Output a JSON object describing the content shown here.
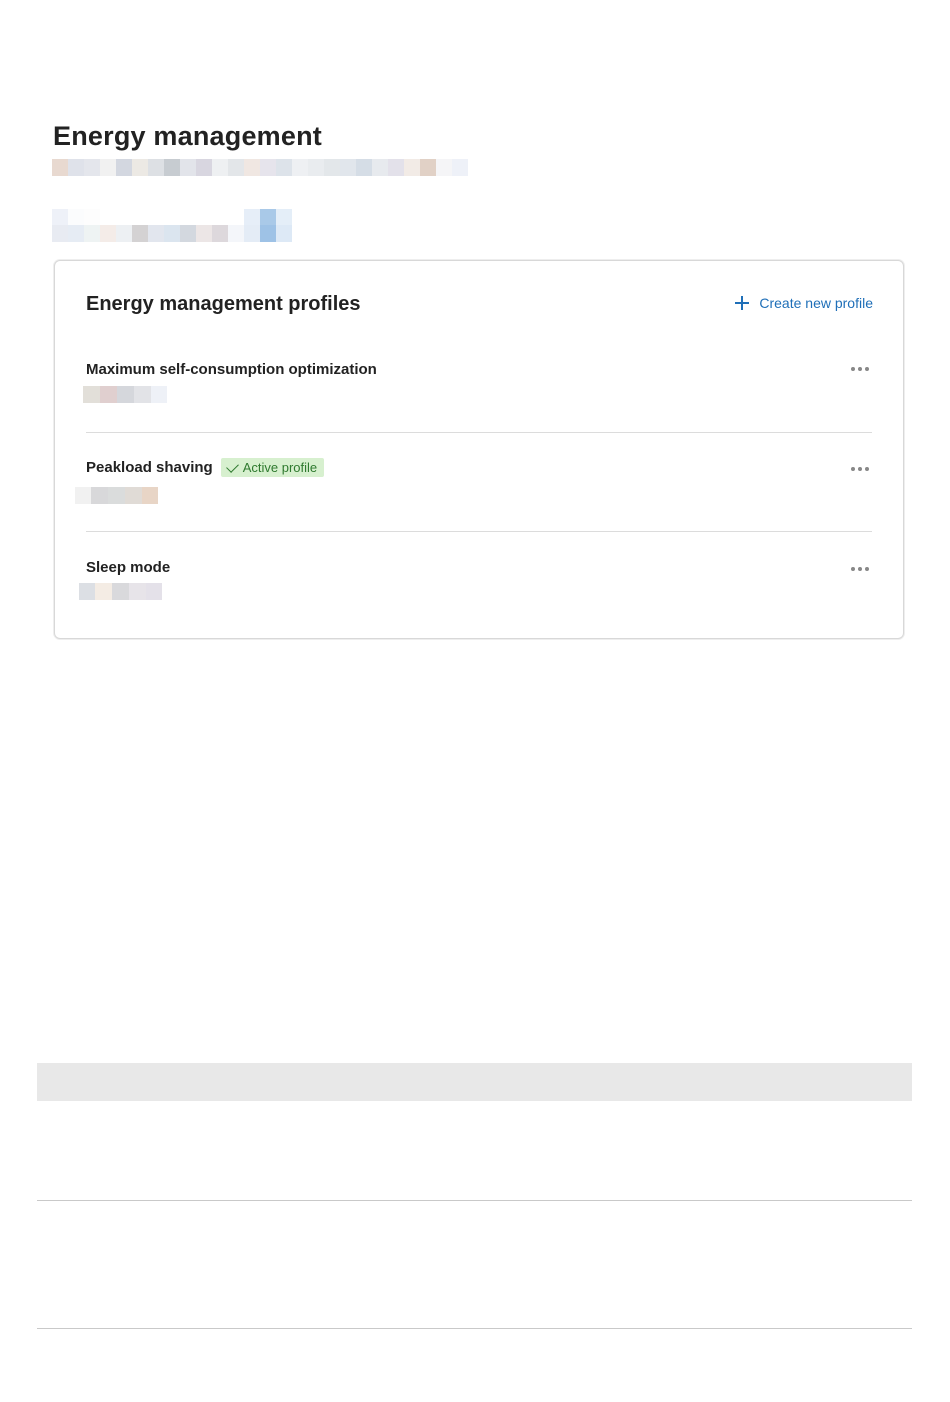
{
  "page": {
    "title": "Energy management"
  },
  "card": {
    "title": "Energy management profiles",
    "create_label": "Create new profile"
  },
  "profiles": [
    {
      "name": "Maximum self-consumption optimization",
      "active": false
    },
    {
      "name": "Peakload shaving",
      "active": true
    },
    {
      "name": "Sleep mode",
      "active": false
    }
  ],
  "badge": {
    "active_label": "Active profile"
  },
  "colors": {
    "accent": "#1f6fb8",
    "badge_bg": "#d7f0cf",
    "badge_text": "#2f7a2f",
    "footer_bar": "#e8e8e8"
  },
  "icons": [
    "plus-icon",
    "check-icon",
    "more-icon"
  ]
}
